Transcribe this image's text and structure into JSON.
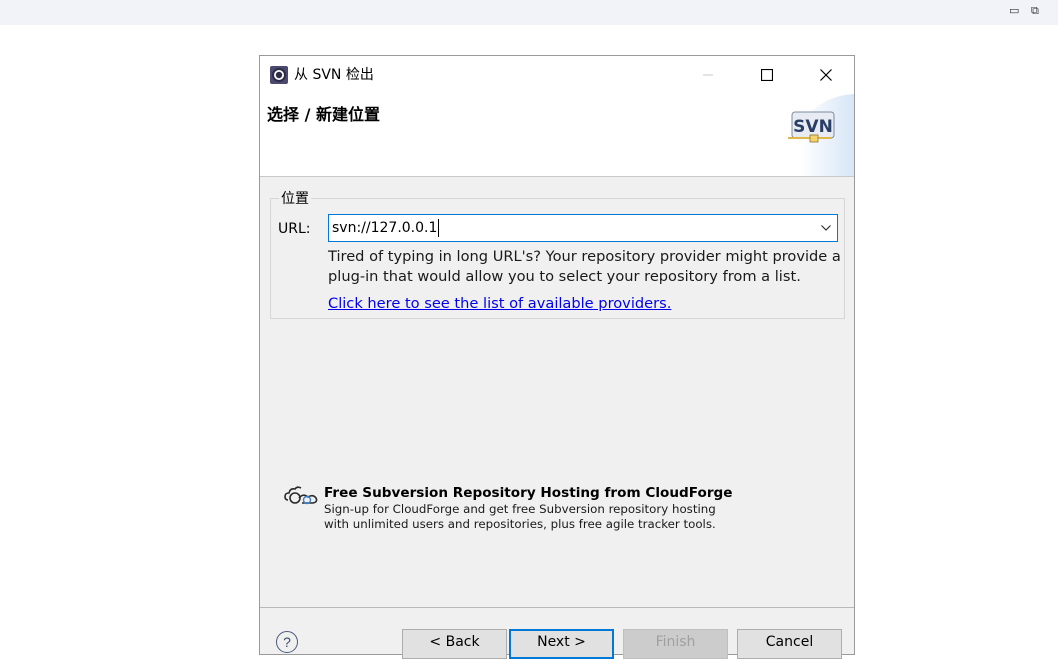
{
  "outer_window": {
    "minimize_glyph": "▭",
    "restore_glyph": "⧉"
  },
  "dialog": {
    "title": "从 SVN 检出",
    "icon": "eclipse-icon",
    "header_title": "选择 / 新建位置",
    "header_logo_text": "SVN",
    "location_group": {
      "legend": "位置",
      "url_label": "URL:",
      "url_value": "svn://127.0.0.1",
      "hint": "Tired of typing in long URL's?  Your repository provider might provide a plug-in that would allow you to select your repository from a list.",
      "providers_link": "Click here to see the list of available providers."
    },
    "cloudforge": {
      "title": "Free Subversion Repository Hosting from CloudForge",
      "description": "Sign-up for CloudForge and get free Subversion repository hosting with unlimited users and repositories, plus free agile tracker tools."
    },
    "footer": {
      "help_glyph": "?",
      "back_label": "< Back",
      "next_label": "Next >",
      "finish_label": "Finish",
      "cancel_label": "Cancel"
    }
  },
  "colors": {
    "accent": "#0078d7",
    "link": "#0000ee",
    "dialog_bg": "#f0f0f0"
  }
}
